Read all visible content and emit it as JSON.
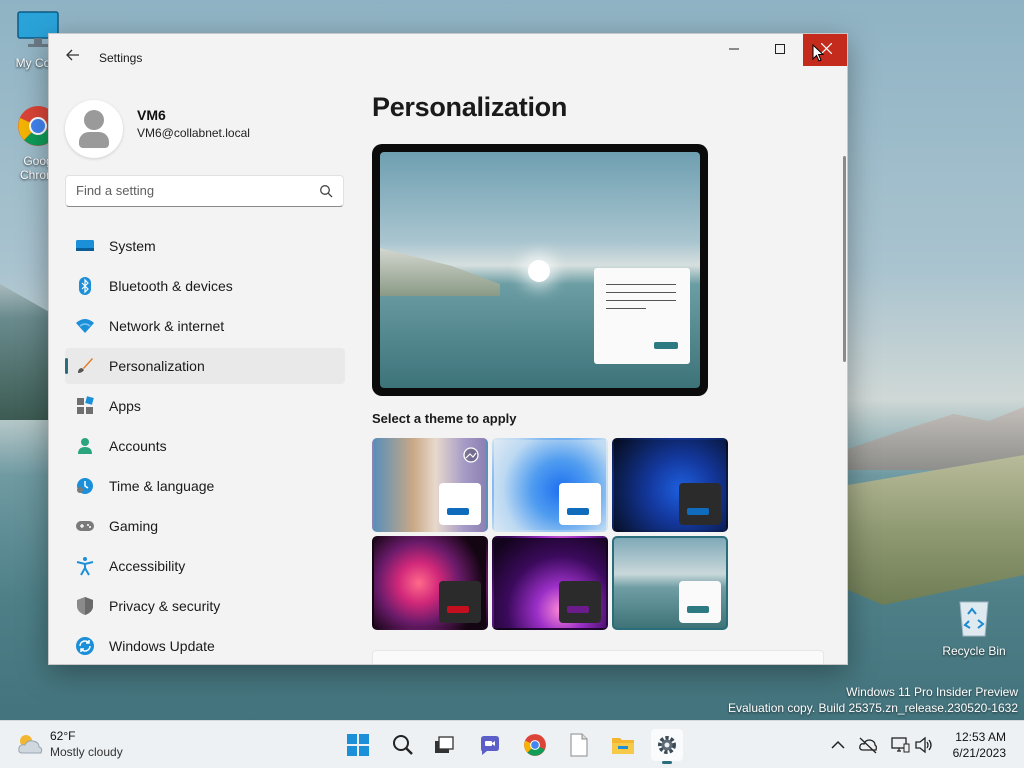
{
  "desktop": {
    "icons": [
      {
        "label": "My Com",
        "icon": "computer-icon"
      },
      {
        "label": "Goog Chrom",
        "icon": "chrome-icon"
      },
      {
        "label": "Recycle Bin",
        "icon": "recycle-bin-icon"
      }
    ],
    "watermark": {
      "line1": "Windows 11 Pro Insider Preview",
      "line2": "Evaluation copy. Build 25375.zn_release.230520-1632"
    }
  },
  "window": {
    "title": "Settings",
    "controls": {
      "minimize": "–",
      "maximize": "□",
      "close": "✕"
    },
    "profile": {
      "name": "VM6",
      "email": "VM6@collabnet.local"
    },
    "search": {
      "placeholder": "Find a setting"
    },
    "nav": [
      {
        "label": "System",
        "icon": "system-icon"
      },
      {
        "label": "Bluetooth & devices",
        "icon": "bluetooth-icon"
      },
      {
        "label": "Network & internet",
        "icon": "wifi-icon"
      },
      {
        "label": "Personalization",
        "icon": "brush-icon",
        "active": true
      },
      {
        "label": "Apps",
        "icon": "apps-icon"
      },
      {
        "label": "Accounts",
        "icon": "accounts-icon"
      },
      {
        "label": "Time & language",
        "icon": "time-language-icon"
      },
      {
        "label": "Gaming",
        "icon": "gaming-icon"
      },
      {
        "label": "Accessibility",
        "icon": "accessibility-icon"
      },
      {
        "label": "Privacy & security",
        "icon": "shield-icon"
      },
      {
        "label": "Windows Update",
        "icon": "windows-update-icon"
      }
    ],
    "page": {
      "title": "Personalization",
      "themes_label": "Select a theme to apply",
      "themes": [
        {
          "name": "theme-spotlight",
          "accent": "#0f6cbd"
        },
        {
          "name": "theme-windows-light",
          "accent": "#0f6cbd"
        },
        {
          "name": "theme-windows-dark",
          "accent": "#0f6cbd"
        },
        {
          "name": "theme-glow",
          "accent": "#c50f1f"
        },
        {
          "name": "theme-captured-motion",
          "accent": "#6b1c8c"
        },
        {
          "name": "theme-flow",
          "accent": "#2d7a82",
          "selected": true
        }
      ]
    }
  },
  "taskbar": {
    "weather": {
      "temp": "62°F",
      "condition": "Mostly cloudy"
    },
    "apps": [
      "start-icon",
      "search-icon",
      "task-view-icon",
      "chat-icon",
      "chrome-icon",
      "notepad-icon",
      "file-explorer-icon",
      "settings-icon"
    ],
    "clock": {
      "time": "12:53 AM",
      "date": "6/21/2023"
    }
  },
  "colors": {
    "accent": "#2b6e7b",
    "close": "#c42b1c"
  }
}
